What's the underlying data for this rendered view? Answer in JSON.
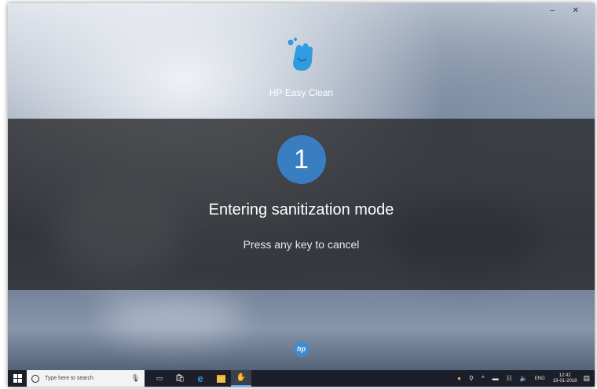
{
  "app": {
    "title": "HP Easy Clean"
  },
  "countdown": {
    "value": "1"
  },
  "dialog": {
    "title": "Entering sanitization mode",
    "hint": "Press any key to cancel"
  },
  "taskbar": {
    "search_placeholder": "Type here to search",
    "language": "ENG",
    "time": "12:42",
    "date": "19-01-2018"
  },
  "colors": {
    "countdown_circle": "#3a7ec2",
    "overlay": "#28282a",
    "taskbar": "#1c1f29",
    "logo_blue": "#2f9be0"
  },
  "icons": {
    "logo": "hand-sparkle-icon",
    "badge": "hp-logo-icon",
    "start": "windows-start-icon",
    "search": "cortana-circle-icon",
    "mic": "microphone-icon",
    "task_view": "task-view-icon",
    "store": "store-icon",
    "edge": "edge-icon",
    "explorer": "file-explorer-icon",
    "easy_clean": "easy-clean-icon"
  }
}
